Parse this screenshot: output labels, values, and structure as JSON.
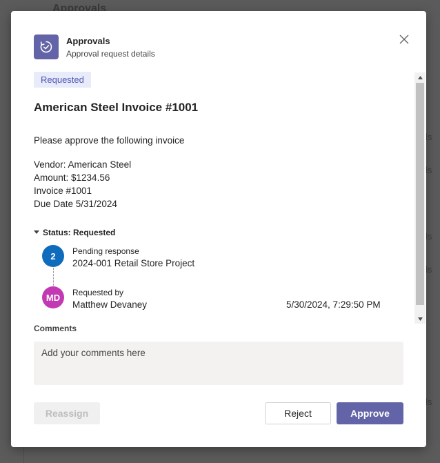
{
  "background": {
    "title": "Approvals",
    "side_fragments": [
      "ls",
      "ls",
      "ls",
      "ls",
      "ls"
    ]
  },
  "dialog": {
    "app_icon": "approvals-icon",
    "app_name": "Approvals",
    "app_subtitle": "Approval request details",
    "close_icon": "close-icon"
  },
  "request": {
    "status_badge": "Requested",
    "title": "American Steel Invoice #1001",
    "intro": "Please approve the following invoice",
    "details": [
      "Vendor: American Steel",
      "Amount: $1234.56",
      "Invoice #1001",
      "Due Date 5/31/2024"
    ]
  },
  "status": {
    "header": "Status: Requested",
    "steps": [
      {
        "badge": "2",
        "label": "Pending response",
        "value": "2024-001 Retail Store Project",
        "color": "#0f6cbd"
      },
      {
        "badge": "MD",
        "label": "Requested by",
        "value": "Matthew Devaney",
        "timestamp": "5/30/2024, 7:29:50 PM",
        "color": "#c239b3"
      }
    ]
  },
  "comments": {
    "label": "Comments",
    "placeholder": "Add your comments here",
    "value": ""
  },
  "actions": {
    "reassign": "Reassign",
    "reject": "Reject",
    "approve": "Approve"
  },
  "colors": {
    "brand": "#6264a7",
    "badge_bg": "#e8ebfa",
    "badge_text": "#4f52b2"
  }
}
